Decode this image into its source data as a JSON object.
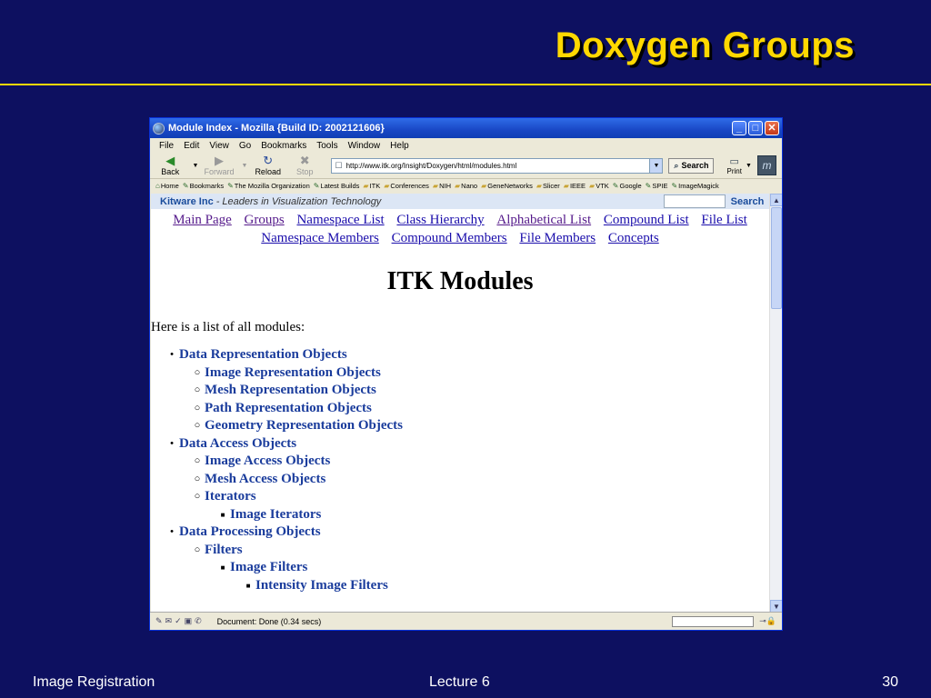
{
  "slide": {
    "title": "Doxygen Groups",
    "footer_left": "Image Registration",
    "footer_center": "Lecture 6",
    "page_number": "30"
  },
  "window": {
    "title": "Module Index - Mozilla {Build ID: 2002121606}",
    "minimize_glyph": "_",
    "maximize_glyph": "□",
    "close_glyph": "✕"
  },
  "menu": [
    "File",
    "Edit",
    "View",
    "Go",
    "Bookmarks",
    "Tools",
    "Window",
    "Help"
  ],
  "toolbar": {
    "back": "Back",
    "forward": "Forward",
    "reload": "Reload",
    "stop": "Stop",
    "url": "http://www.itk.org/Insight/Doxygen/html/modules.html",
    "search": "Search",
    "print": "Print"
  },
  "bookmarks": [
    "Home",
    "Bookmarks",
    "The Mozilla Organization",
    "Latest Builds",
    "ITK",
    "Conferences",
    "NIH",
    "Nano",
    "GeneNetworks",
    "Slicer",
    "IEEE",
    "VTK",
    "Google",
    "SPIE",
    "ImageMagick"
  ],
  "page": {
    "kitware_name": "Kitware Inc",
    "kitware_tagline": "- Leaders in Visualization Technology",
    "kitware_search": "Search",
    "nav_links": [
      {
        "label": "Main Page",
        "visited": true
      },
      {
        "label": "Groups",
        "visited": true
      },
      {
        "label": "Namespace List",
        "visited": false
      },
      {
        "label": "Class Hierarchy",
        "visited": false
      },
      {
        "label": "Alphabetical List",
        "visited": true
      },
      {
        "label": "Compound List",
        "visited": false
      },
      {
        "label": "File List",
        "visited": false
      },
      {
        "label": "Namespace Members",
        "visited": false
      },
      {
        "label": "Compound Members",
        "visited": false
      },
      {
        "label": "File Members",
        "visited": false
      },
      {
        "label": "Concepts",
        "visited": false
      }
    ],
    "heading": "ITK Modules",
    "intro": "Here is a list of all modules:",
    "modules": [
      {
        "level": 0,
        "label": "Data Representation Objects"
      },
      {
        "level": 1,
        "label": "Image Representation Objects"
      },
      {
        "level": 1,
        "label": "Mesh Representation Objects"
      },
      {
        "level": 1,
        "label": "Path Representation Objects"
      },
      {
        "level": 1,
        "label": "Geometry Representation Objects"
      },
      {
        "level": 0,
        "label": "Data Access Objects"
      },
      {
        "level": 1,
        "label": "Image Access Objects"
      },
      {
        "level": 1,
        "label": "Mesh Access Objects"
      },
      {
        "level": 1,
        "label": "Iterators"
      },
      {
        "level": 2,
        "label": "Image Iterators"
      },
      {
        "level": 0,
        "label": "Data Processing Objects"
      },
      {
        "level": 1,
        "label": "Filters"
      },
      {
        "level": 2,
        "label": "Image Filters"
      },
      {
        "level": 3,
        "label": "Intensity Image Filters"
      }
    ]
  },
  "status": {
    "text": "Document: Done (0.34 secs)"
  }
}
